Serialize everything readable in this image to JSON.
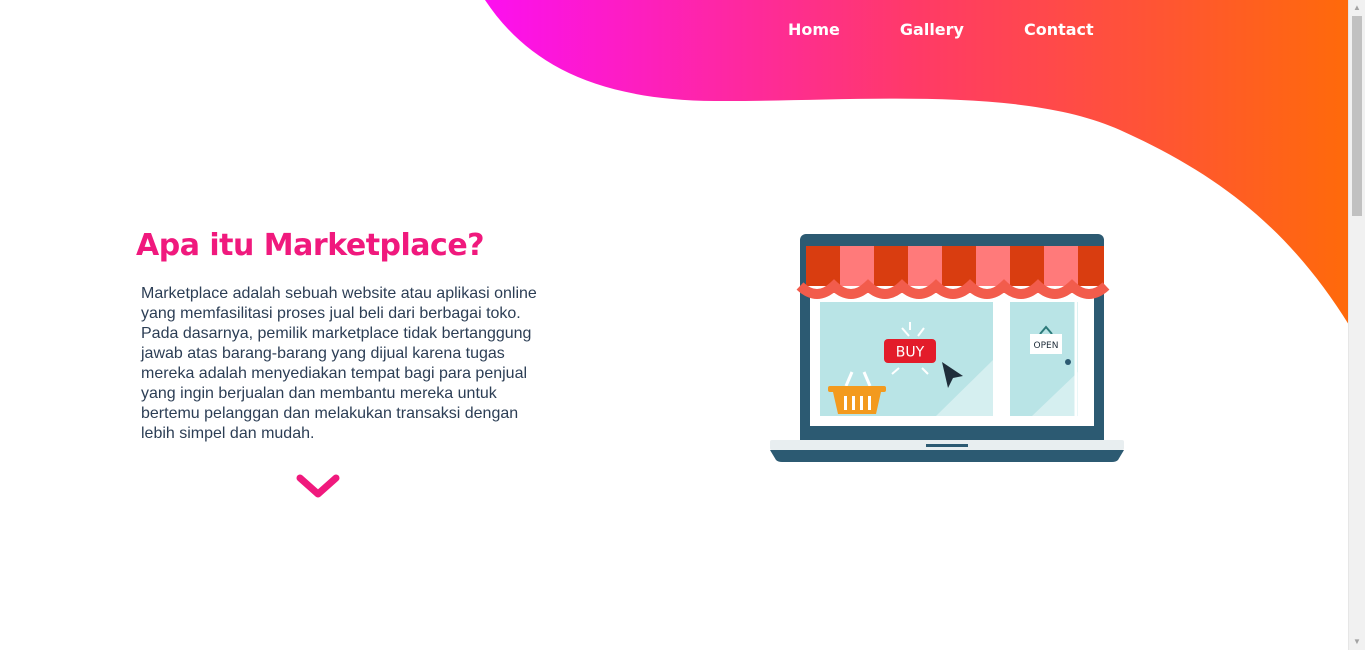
{
  "nav": {
    "items": [
      {
        "label": "Home"
      },
      {
        "label": "Gallery"
      },
      {
        "label": "Contact"
      }
    ]
  },
  "hero": {
    "title": "Apa itu Marketplace?",
    "description": "Marketplace adalah sebuah website atau aplikasi online yang memfasilitasi proses jual beli dari berbagai toko. Pada dasarnya, pemilik marketplace tidak bertanggung jawab atas barang-barang yang dijual karena tugas mereka adalah menyediakan tempat bagi para penjual yang ingin berjualan dan membantu mereka untuk bertemu pelanggan dan melakukan transaksi dengan lebih simpel dan mudah.",
    "scroll_icon": "chevron-down-icon"
  },
  "illustration": {
    "buy_label": "BUY",
    "open_label": "OPEN"
  },
  "colors": {
    "gradient_start": "#fc0ff0",
    "gradient_mid": "#ff3a67",
    "gradient_end": "#ff6a0a",
    "title": "#f0197d",
    "text": "#2c3e55",
    "laptop": "#2c5a72"
  }
}
